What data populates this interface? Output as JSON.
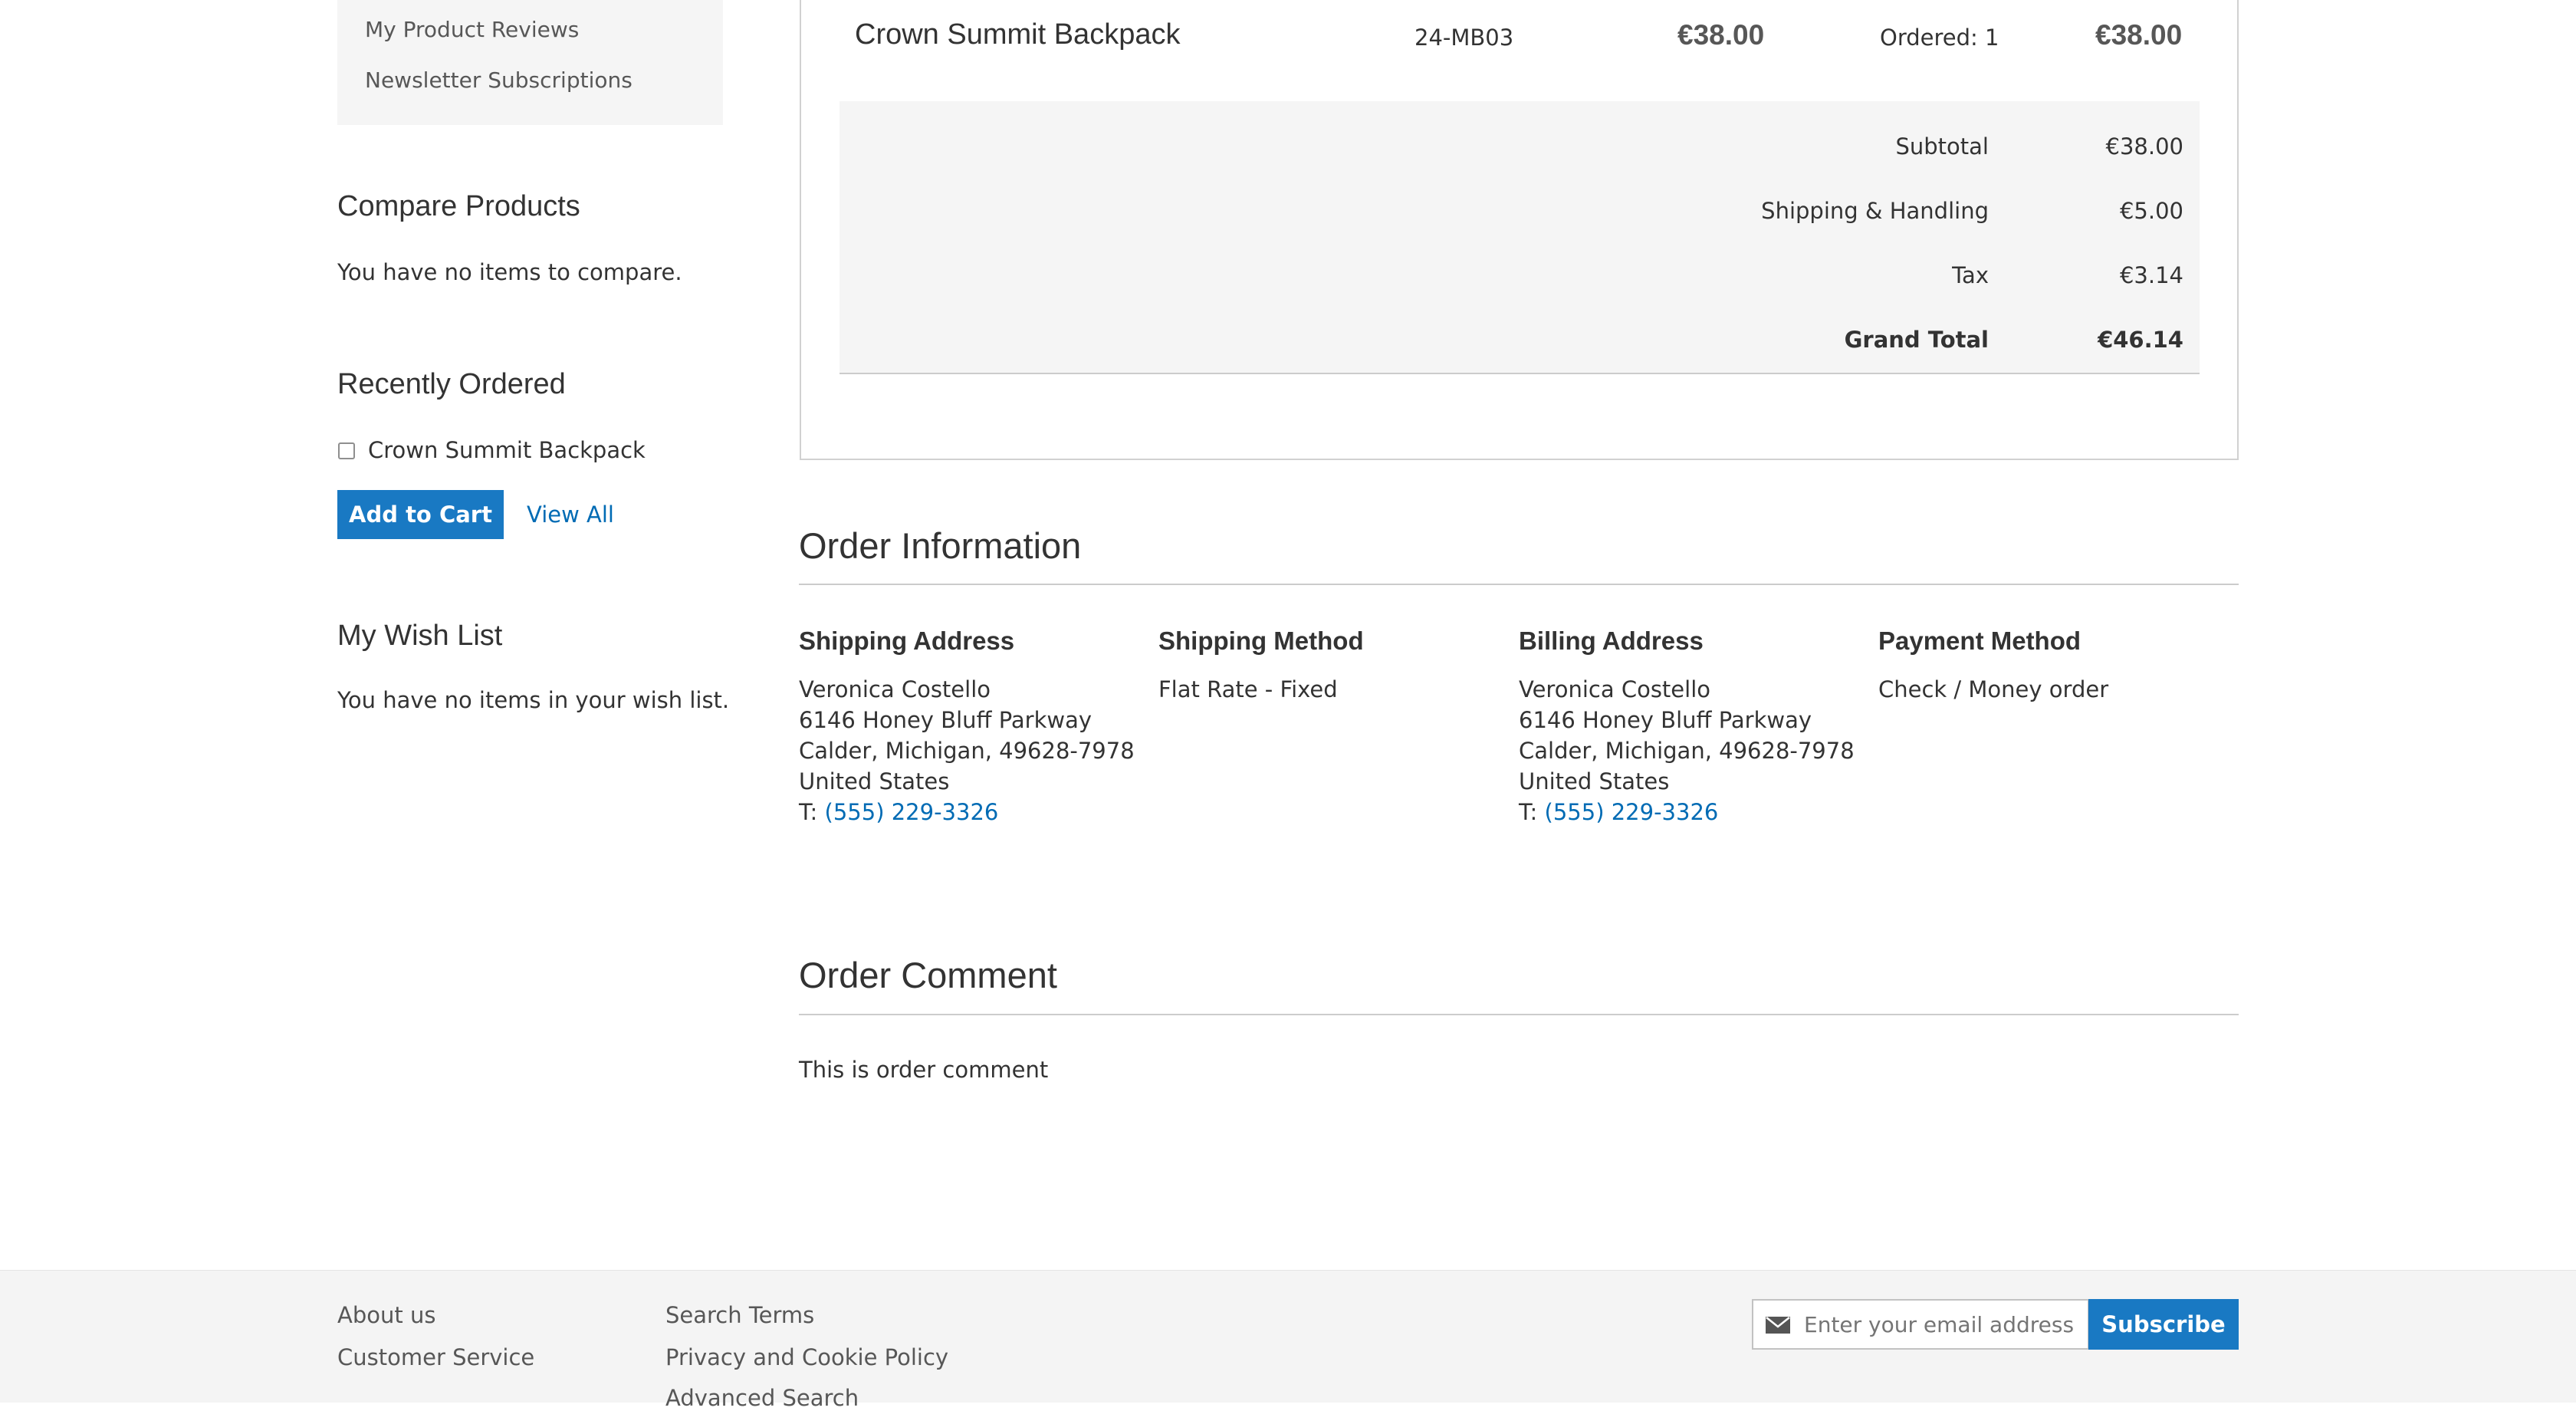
{
  "account_nav": {
    "items": [
      {
        "label": "My Product Reviews"
      },
      {
        "label": "Newsletter Subscriptions"
      }
    ]
  },
  "compare": {
    "title": "Compare Products",
    "empty_text": "You have no items to compare."
  },
  "recently_ordered": {
    "title": "Recently Ordered",
    "items": [
      {
        "label": "Crown Summit Backpack",
        "checked": false
      }
    ],
    "add_to_cart_label": "Add to Cart",
    "view_all_label": "View All"
  },
  "wishlist": {
    "title": "My Wish List",
    "empty_text": "You have no items in your wish list."
  },
  "order_item": {
    "name": "Crown Summit Backpack",
    "sku": "24-MB03",
    "price": "€38.00",
    "qty": "Ordered: 1",
    "subtotal": "€38.00"
  },
  "totals": {
    "subtotal_label": "Subtotal",
    "subtotal_value": "€38.00",
    "shipping_label": "Shipping & Handling",
    "shipping_value": "€5.00",
    "tax_label": "Tax",
    "tax_value": "€3.14",
    "grand_total_label": "Grand Total",
    "grand_total_value": "€46.14"
  },
  "order_information": {
    "title": "Order Information",
    "shipping_address": {
      "title": "Shipping Address",
      "name": "Veronica Costello",
      "street": "6146 Honey Bluff Parkway",
      "city_line": "Calder, Michigan, 49628-7978",
      "country": "United States",
      "phone_prefix": "T: ",
      "phone": "(555) 229-3326"
    },
    "shipping_method": {
      "title": "Shipping Method",
      "value": "Flat Rate - Fixed"
    },
    "billing_address": {
      "title": "Billing Address",
      "name": "Veronica Costello",
      "street": "6146 Honey Bluff Parkway",
      "city_line": "Calder, Michigan, 49628-7978",
      "country": "United States",
      "phone_prefix": "T: ",
      "phone": "(555) 229-3326"
    },
    "payment_method": {
      "title": "Payment Method",
      "value": "Check / Money order"
    }
  },
  "order_comment": {
    "title": "Order Comment",
    "text": "This is order comment"
  },
  "footer": {
    "col1": [
      {
        "label": "About us"
      },
      {
        "label": "Customer Service"
      }
    ],
    "col2": [
      {
        "label": "Search Terms"
      },
      {
        "label": "Privacy and Cookie Policy"
      },
      {
        "label": "Advanced Search"
      }
    ],
    "newsletter_placeholder": "Enter your email address",
    "subscribe_label": "Subscribe"
  },
  "colors": {
    "primary_button": "#1979c3",
    "link": "#006bb4"
  },
  "icons": {
    "newsletter": "envelope-icon"
  }
}
